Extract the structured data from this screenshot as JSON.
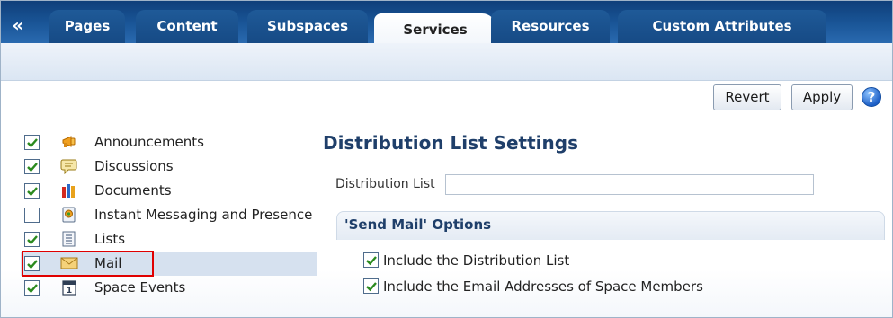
{
  "nav": {
    "collapse_glyph": "«",
    "tabs": [
      {
        "label": "Pages",
        "active": false
      },
      {
        "label": "Content",
        "active": false
      },
      {
        "label": "Subspaces",
        "active": false
      },
      {
        "label": "Services",
        "active": true
      },
      {
        "label": "Resources",
        "active": false
      },
      {
        "label": "Custom Attributes",
        "active": false
      }
    ]
  },
  "toolbar": {
    "revert_label": "Revert",
    "apply_label": "Apply",
    "help_glyph": "?"
  },
  "services": [
    {
      "label": "Announcements",
      "checked": true,
      "icon": "megaphone-icon"
    },
    {
      "label": "Discussions",
      "checked": true,
      "icon": "speech-bubble-icon"
    },
    {
      "label": "Documents",
      "checked": true,
      "icon": "books-icon"
    },
    {
      "label": "Instant Messaging and Presence",
      "checked": false,
      "icon": "im-presence-icon"
    },
    {
      "label": "Lists",
      "checked": true,
      "icon": "list-icon"
    },
    {
      "label": "Mail",
      "checked": true,
      "icon": "envelope-icon",
      "selected": true
    },
    {
      "label": "Space Events",
      "checked": true,
      "icon": "calendar-icon"
    }
  ],
  "settings": {
    "title": "Distribution List Settings",
    "distribution_list_label": "Distribution List",
    "distribution_list_value": "",
    "send_mail_options_title": "'Send Mail' Options",
    "options": [
      {
        "label": "Include the Distribution List",
        "checked": true
      },
      {
        "label": "Include the Email Addresses of Space Members",
        "checked": true
      }
    ]
  },
  "colors": {
    "tab_bar": "#1a5698",
    "selected_row": "#d6e1ef",
    "highlight": "#e00000",
    "heading": "#1f3f6a"
  }
}
